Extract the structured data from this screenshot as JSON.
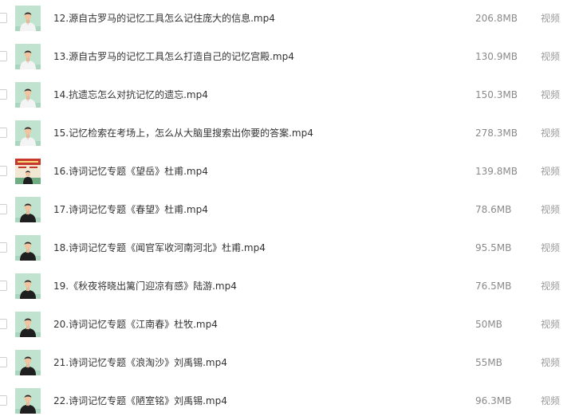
{
  "files": [
    {
      "name": "12.源自古罗马的记忆工具怎么记住庞大的信息.mp4",
      "size": "206.8MB",
      "type": "视频",
      "thumbnail": "presenter-white-shirt"
    },
    {
      "name": "13.源自古罗马的记忆工具怎么打造自己的记忆宫殿.mp4",
      "size": "130.9MB",
      "type": "视频",
      "thumbnail": "presenter-white-shirt"
    },
    {
      "name": "14.抗遗忘怎么对抗记忆的遗忘.mp4",
      "size": "150.3MB",
      "type": "视频",
      "thumbnail": "presenter-white-shirt"
    },
    {
      "name": "15.记忆检索在考场上，怎么从大脑里搜索出你要的答案.mp4",
      "size": "278.3MB",
      "type": "视频",
      "thumbnail": "presenter-white-shirt"
    },
    {
      "name": "16.诗词记忆专题《望岳》杜甫.mp4",
      "size": "139.8MB",
      "type": "视频",
      "thumbnail": "title-card-red"
    },
    {
      "name": "17.诗词记忆专题《春望》杜甫.mp4",
      "size": "78.6MB",
      "type": "视频",
      "thumbnail": "presenter-black-shirt"
    },
    {
      "name": "18.诗词记忆专题《闻官军收河南河北》杜甫.mp4",
      "size": "95.5MB",
      "type": "视频",
      "thumbnail": "presenter-black-shirt"
    },
    {
      "name": "19.《秋夜将晓出篱门迎凉有感》陆游.mp4",
      "size": "76.5MB",
      "type": "视频",
      "thumbnail": "presenter-black-shirt"
    },
    {
      "name": "20.诗词记忆专题《江南春》杜牧.mp4",
      "size": "50MB",
      "type": "视频",
      "thumbnail": "presenter-black-shirt"
    },
    {
      "name": "21.诗词记忆专题《浪淘沙》刘禹锡.mp4",
      "size": "55MB",
      "type": "视频",
      "thumbnail": "presenter-black-shirt"
    },
    {
      "name": "22.诗词记忆专题《陋室铭》刘禹锡.mp4",
      "size": "96.3MB",
      "type": "视频",
      "thumbnail": "presenter-black-shirt"
    }
  ]
}
